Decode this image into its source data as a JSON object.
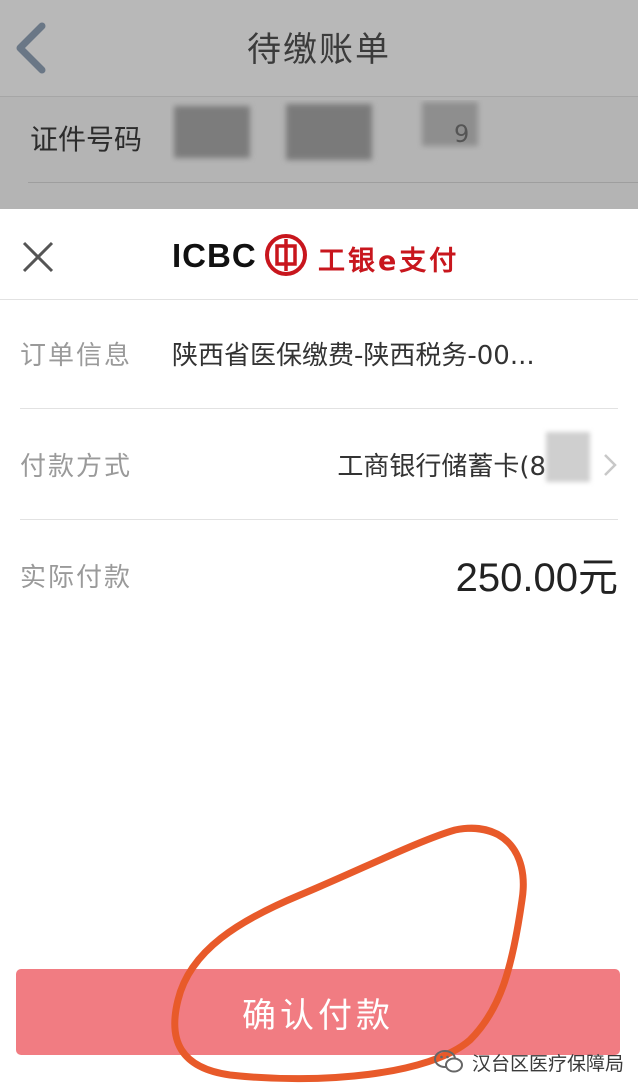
{
  "background_page": {
    "title": "待缴账单",
    "id_label": "证件号码",
    "id_value_partial": "9"
  },
  "sheet": {
    "brand_text": "ICBC",
    "brand_name": "工银e支付",
    "order_label": "订单信息",
    "order_value": "陕西省医保缴费-陕西税务-00...",
    "method_label": "付款方式",
    "method_value": "工商银行储蓄卡(8",
    "amount_label": "实际付款",
    "amount_value": "250.00元",
    "confirm_label": "确认付款"
  },
  "watermark": {
    "text": "汉台区医疗保障局"
  },
  "colors": {
    "confirm_button": "#f17c82",
    "brand_red": "#c8161d",
    "annotation_circle": "#e85a2a"
  }
}
